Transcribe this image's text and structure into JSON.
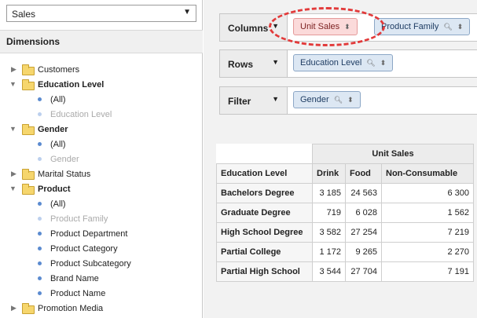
{
  "cube_selector": {
    "value": "Sales"
  },
  "dimensions": {
    "header": "Dimensions",
    "tree": [
      {
        "label": "Customers",
        "type": "folder",
        "expanded": false
      },
      {
        "label": "Education Level",
        "type": "folder",
        "expanded": true
      },
      {
        "label": "(All)",
        "type": "level"
      },
      {
        "label": "Education Level",
        "type": "level",
        "disabled": true
      },
      {
        "label": "Gender",
        "type": "folder",
        "expanded": true
      },
      {
        "label": "(All)",
        "type": "level"
      },
      {
        "label": "Gender",
        "type": "level",
        "disabled": true
      },
      {
        "label": "Marital Status",
        "type": "folder",
        "expanded": false
      },
      {
        "label": "Product",
        "type": "folder",
        "expanded": true
      },
      {
        "label": "(All)",
        "type": "level"
      },
      {
        "label": "Product Family",
        "type": "level",
        "disabled": true
      },
      {
        "label": "Product Department",
        "type": "level"
      },
      {
        "label": "Product Category",
        "type": "level"
      },
      {
        "label": "Product Subcategory",
        "type": "level"
      },
      {
        "label": "Brand Name",
        "type": "level"
      },
      {
        "label": "Product Name",
        "type": "level"
      },
      {
        "label": "Promotion Media",
        "type": "folder",
        "expanded": false
      }
    ]
  },
  "axes": {
    "columns": {
      "label": "Columns",
      "chips": [
        "Unit Sales",
        "Product Family"
      ]
    },
    "rows": {
      "label": "Rows",
      "chips": [
        "Education Level"
      ]
    },
    "filter": {
      "label": "Filter",
      "chips": [
        "Gender"
      ]
    }
  },
  "table": {
    "measure": "Unit Sales",
    "row_header": "Education Level",
    "columns": [
      "Drink",
      "Food",
      "Non-Consumable"
    ],
    "rows": [
      {
        "label": "Bachelors Degree",
        "values": [
          "3 185",
          "24 563",
          "6 300"
        ]
      },
      {
        "label": "Graduate Degree",
        "values": [
          "719",
          "6 028",
          "1 562"
        ]
      },
      {
        "label": "High School Degree",
        "values": [
          "3 582",
          "27 254",
          "7 219"
        ]
      },
      {
        "label": "Partial College",
        "values": [
          "1 172",
          "9 265",
          "2 270"
        ]
      },
      {
        "label": "Partial High School",
        "values": [
          "3 544",
          "27 704",
          "7 191"
        ]
      }
    ]
  },
  "colors": {
    "highlight_oval": "#e23a3a",
    "chip_blue": "#dce7f3",
    "chip_pink": "#fbdada"
  }
}
